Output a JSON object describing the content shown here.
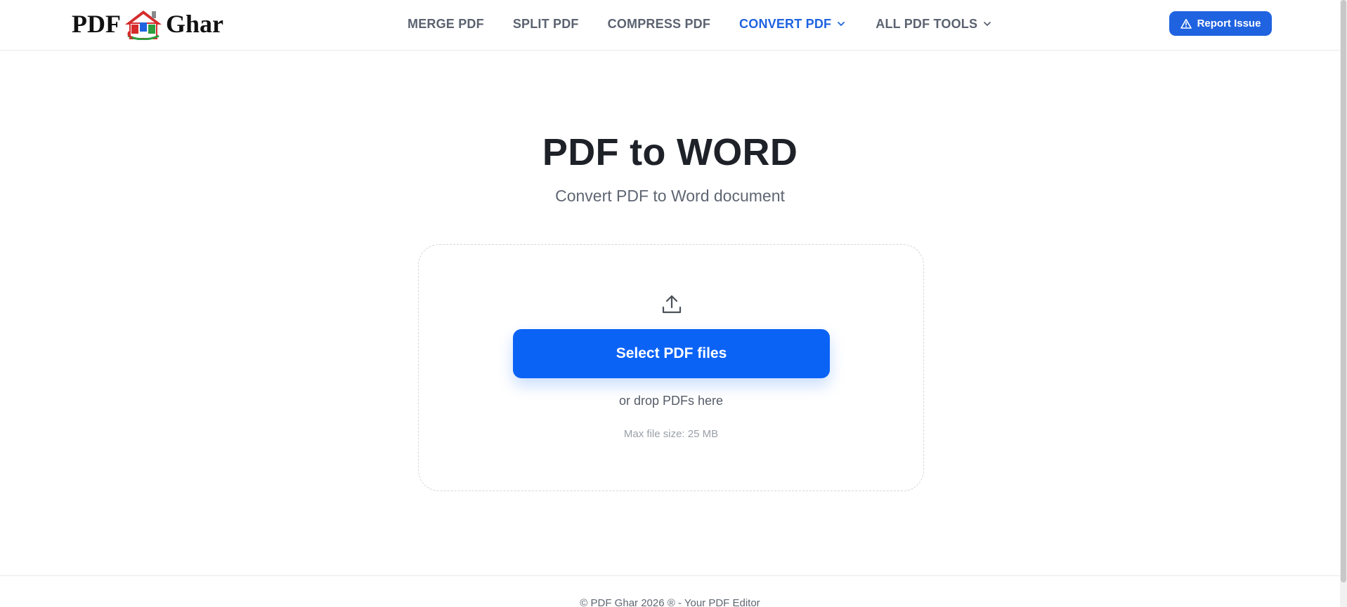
{
  "header": {
    "logo": {
      "left_text": "PDF",
      "right_text": "Ghar",
      "icon": "house-logo-icon"
    },
    "nav": [
      {
        "label": "MERGE PDF",
        "active": false,
        "dropdown": false
      },
      {
        "label": "SPLIT PDF",
        "active": false,
        "dropdown": false
      },
      {
        "label": "COMPRESS PDF",
        "active": false,
        "dropdown": false
      },
      {
        "label": "CONVERT PDF",
        "active": true,
        "dropdown": true
      },
      {
        "label": "ALL PDF TOOLS",
        "active": false,
        "dropdown": true
      }
    ],
    "report_button": {
      "label": "Report Issue",
      "icon": "warning-triangle-icon"
    }
  },
  "main": {
    "title": "PDF to WORD",
    "subtitle": "Convert PDF to Word document",
    "dropzone": {
      "icon": "upload-icon",
      "button_label": "Select PDF files",
      "drop_text": "or drop PDFs here",
      "max_size_text": "Max file size: 25 MB"
    }
  },
  "footer": {
    "text": "© PDF Ghar 2026 ® - Your PDF Editor"
  },
  "colors": {
    "accent": "#1f63e0",
    "primary_button": "#0b63f6",
    "nav_text": "#5b6270",
    "title_text": "#1e2228"
  }
}
